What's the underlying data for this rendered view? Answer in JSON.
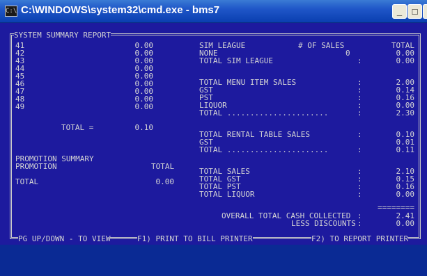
{
  "window": {
    "title": "C:\\WINDOWS\\system32\\cmd.exe - bms7",
    "icon": "cmd-icon",
    "icon_glyph": "C:\\",
    "minimize_label": "_",
    "maximize_label": "□",
    "close_label": "×"
  },
  "report": {
    "header": "SYSTEM SUMMARY REPORT",
    "rows": [
      {
        "num": "41",
        "val": "0.00"
      },
      {
        "num": "42",
        "val": "0.00"
      },
      {
        "num": "43",
        "val": "0.00"
      },
      {
        "num": "44",
        "val": "0.00"
      },
      {
        "num": "45",
        "val": "0.00"
      },
      {
        "num": "46",
        "val": "0.00"
      },
      {
        "num": "47",
        "val": "0.00"
      },
      {
        "num": "48",
        "val": "0.00"
      },
      {
        "num": "49",
        "val": "0.00"
      }
    ],
    "total_label": "TOTAL =",
    "total_value": "0.10",
    "promo": {
      "title": "PROMOTION SUMMARY",
      "col_promotion": "PROMOTION",
      "col_total": "TOTAL",
      "total_label": "TOTAL",
      "total_value": "0.00"
    },
    "right": {
      "sim_league": "SIM LEAGUE",
      "num_sales_label": "# OF SALES",
      "total_col": "TOTAL",
      "none_label": "NONE",
      "none_count": "0",
      "none_total": "0.00",
      "total_sim_league": "TOTAL SIM LEAGUE",
      "total_sim_league_val": "0.00",
      "menu_sales": "TOTAL MENU ITEM SALES",
      "menu_sales_val": "2.00",
      "gst": "GST",
      "gst_val": "0.14",
      "pst": "PST",
      "pst_val": "0.16",
      "liquor": "LIQUOR",
      "liquor_val": "0.00",
      "menu_total": "TOTAL ......................",
      "menu_total_val": "2.30",
      "rental_sales": "TOTAL RENTAL TABLE SALES",
      "rental_sales_val": "0.10",
      "rental_gst": "GST",
      "rental_gst_val": "0.01",
      "rental_total": "TOTAL ......................",
      "rental_total_val": "0.11",
      "total_sales": "TOTAL SALES",
      "total_sales_val": "2.10",
      "total_gst": "TOTAL GST",
      "total_gst_val": "0.15",
      "total_pst": "TOTAL PST",
      "total_pst_val": "0.16",
      "total_liquor": "TOTAL LIQUOR",
      "total_liquor_val": "0.00",
      "separator": "========",
      "overall": "OVERALL TOTAL CASH COLLECTED",
      "overall_val": "2.41",
      "discounts": "LESS DISCOUNTS",
      "discounts_val": "0.00",
      "colon": ":"
    },
    "footer": {
      "nav": "PG UP/DOWN - TO VIEW",
      "f1": "F1) PRINT TO BILL PRINTER",
      "f2": "F2) TO REPORT PRINTER"
    }
  }
}
